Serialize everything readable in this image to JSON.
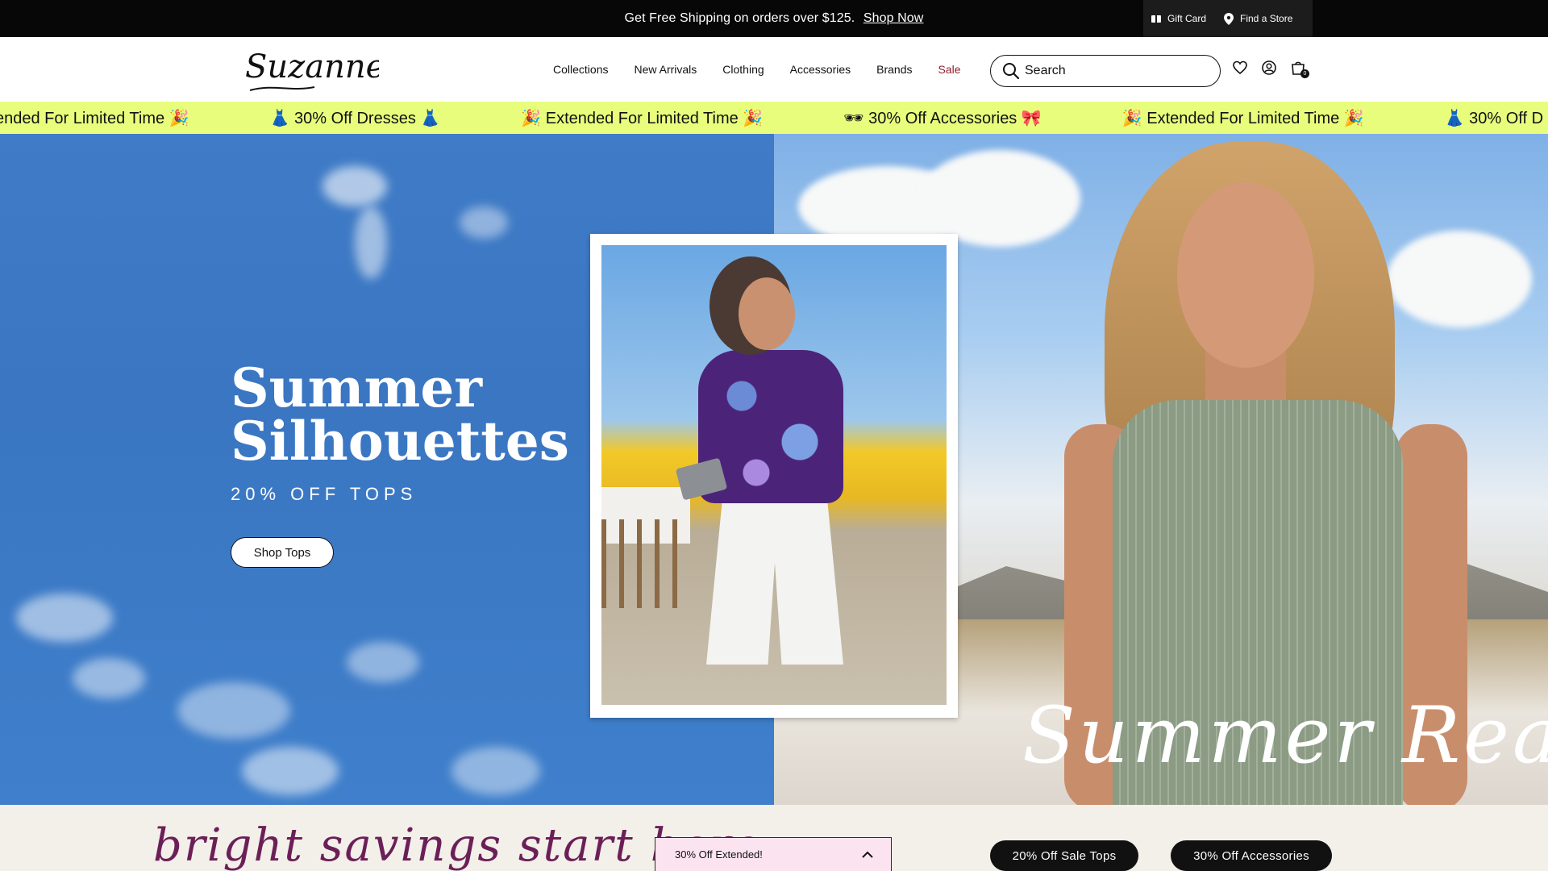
{
  "announcement": {
    "text": "Get Free Shipping on orders over $125.",
    "link": "Shop Now"
  },
  "utility": {
    "gift_card": "Gift Card",
    "find_store": "Find a Store"
  },
  "header": {
    "logo_text": "Suzanne's",
    "nav": [
      "Collections",
      "New Arrivals",
      "Clothing",
      "Accessories",
      "Brands",
      "Sale"
    ],
    "search_placeholder": "Search",
    "cart_count": "0",
    "icons": [
      "search-icon",
      "heart-icon",
      "account-icon",
      "bag-icon"
    ]
  },
  "ribbon": {
    "messages": [
      "ended For Limited Time 🎉",
      "👗 30% Off Dresses 👗",
      "🎉 Extended For Limited Time 🎉",
      "🕶 30% Off Accessories 🎀",
      "🎉 Extended For Limited Time 🎉",
      "👗 30% Off D"
    ],
    "background": "#e8fd7c"
  },
  "hero": {
    "title_line1": "Summer",
    "title_line2": "Silhouettes",
    "subtitle": "20% OFF TOPS",
    "button": "Shop Tops",
    "script_text": "Summer Ready"
  },
  "savings": {
    "title": "bright savings start here",
    "dropdown": "30% Off Extended!",
    "pill1": "20% Off Sale Tops",
    "pill2": "30% Off Accessories",
    "title_color": "#6b1f57"
  }
}
